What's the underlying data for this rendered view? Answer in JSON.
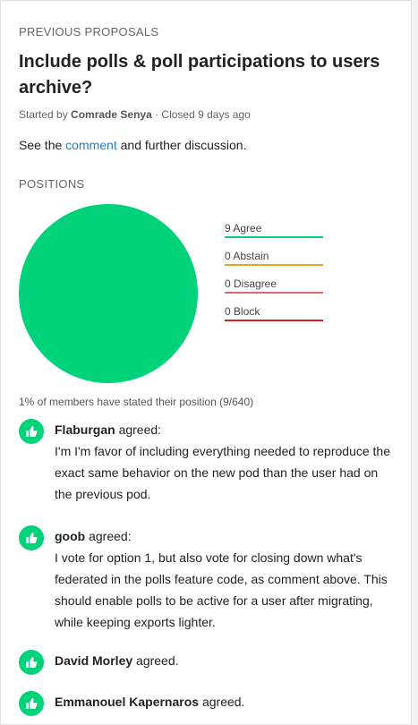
{
  "header": {
    "section_label": "PREVIOUS PROPOSALS",
    "title": "Include polls & poll participations to users archive?"
  },
  "meta": {
    "started_by": "Started by",
    "author": "Comrade Senya",
    "closed": "· Closed 9 days ago"
  },
  "description": {
    "prefix": "See the",
    "link": "comment",
    "suffix": "and further discussion."
  },
  "positions": {
    "label": "POSITIONS",
    "legend": [
      {
        "label": "9 Agree",
        "count": 9,
        "color": "#00d27a"
      },
      {
        "label": "0 Abstain",
        "count": 0,
        "color": "#f0a020"
      },
      {
        "label": "0 Disagree",
        "count": 0,
        "color": "#e06a6a"
      },
      {
        "label": "0 Block",
        "count": 0,
        "color": "#cc2222"
      }
    ],
    "stats": "1% of members have stated their position (9/640)"
  },
  "stances": [
    {
      "name": "Flaburgan",
      "verb": "agreed:",
      "comment": "I'm I'm favor of including everything needed to reproduce the exact same behavior on the new pod than the user had on the previous pod."
    },
    {
      "name": "goob",
      "verb": "agreed:",
      "comment": "I vote for option 1, but also vote for closing down what's federated in the polls feature code, as comment above. This should enable polls to be active for a user after migrating, while keeping exports lighter."
    },
    {
      "name": "David Morley",
      "verb": "agreed.",
      "comment": ""
    },
    {
      "name": "Emmanouel Kapernaros",
      "verb": "agreed.",
      "comment": ""
    }
  ],
  "colors": {
    "agree": "#00d27a",
    "link": "#2a7fc0"
  }
}
